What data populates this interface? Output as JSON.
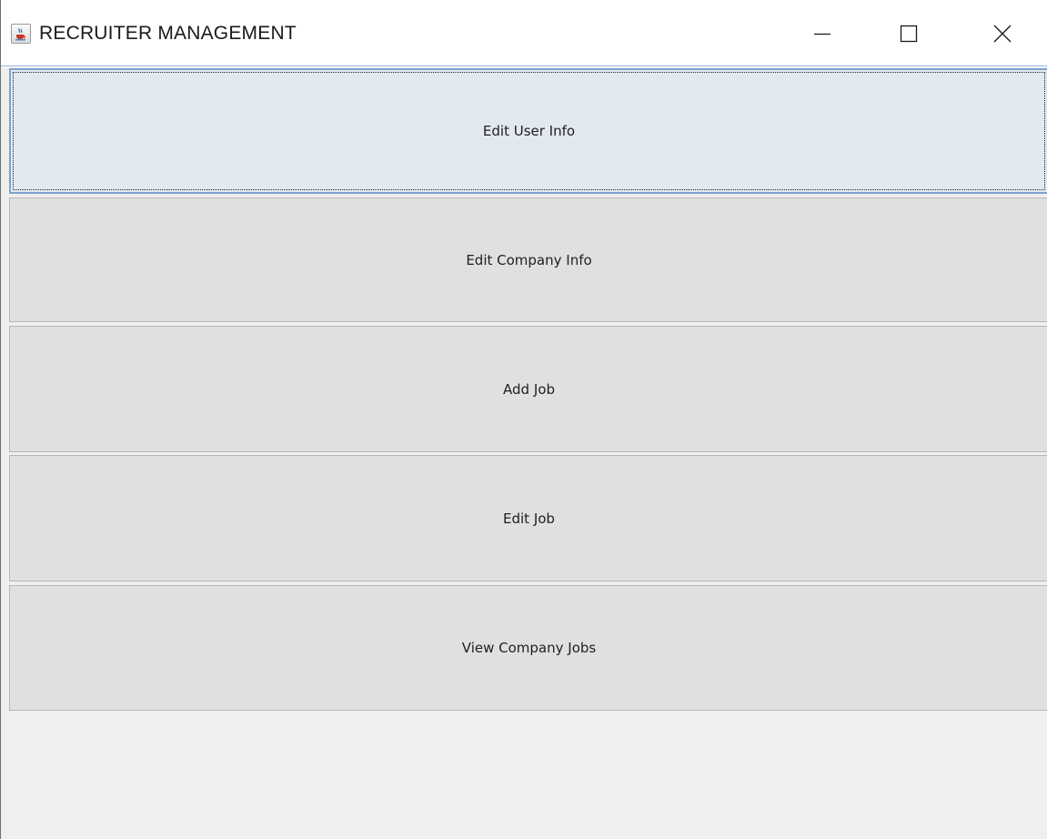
{
  "window": {
    "title": "RECRUITER MANAGEMENT",
    "app_icon": "java-cup-icon",
    "controls": {
      "minimize_icon": "minimize-icon",
      "maximize_icon": "maximize-icon",
      "close_icon": "close-icon"
    }
  },
  "menu": {
    "buttons": [
      {
        "label": "Edit User Info",
        "focused": true
      },
      {
        "label": "Edit Company Info",
        "focused": false
      },
      {
        "label": "Add Job",
        "focused": false
      },
      {
        "label": "Edit Job",
        "focused": false
      },
      {
        "label": "View Company Jobs",
        "focused": false
      }
    ]
  },
  "colors": {
    "button_bg": "#e0e0e0",
    "focused_button_bg": "#e3e9f1",
    "focused_border": "#7da2ce",
    "panel_bg": "#efefef",
    "titlebar_bg": "#ffffff"
  }
}
